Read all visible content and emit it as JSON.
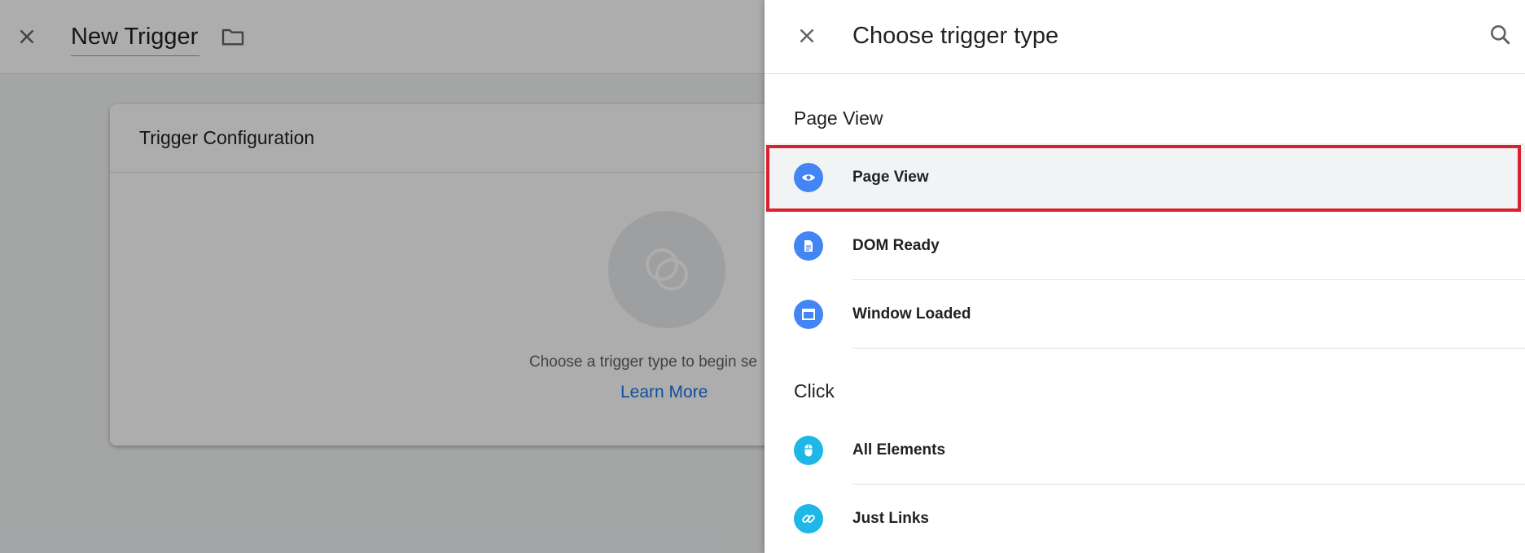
{
  "editor": {
    "trigger_name": "New Trigger",
    "card_title": "Trigger Configuration",
    "hint_text": "Choose a trigger type to begin se",
    "learn_more": "Learn More"
  },
  "drawer": {
    "title": "Choose trigger type",
    "sections": [
      {
        "heading": "Page View",
        "items": [
          {
            "label": "Page View",
            "icon": "eye-icon",
            "color": "#4285f4",
            "selected": true
          },
          {
            "label": "DOM Ready",
            "icon": "document-icon",
            "color": "#4285f4",
            "selected": false
          },
          {
            "label": "Window Loaded",
            "icon": "window-icon",
            "color": "#4285f4",
            "selected": false
          }
        ]
      },
      {
        "heading": "Click",
        "items": [
          {
            "label": "All Elements",
            "icon": "mouse-icon",
            "color": "#1fb6e8",
            "selected": false
          },
          {
            "label": "Just Links",
            "icon": "link-icon",
            "color": "#1fb6e8",
            "selected": false
          }
        ]
      }
    ]
  },
  "colors": {
    "accent_blue": "#4285f4",
    "click_cyan": "#1fb6e8",
    "link_blue": "#1a73e8",
    "highlight_red": "#d9212f"
  }
}
